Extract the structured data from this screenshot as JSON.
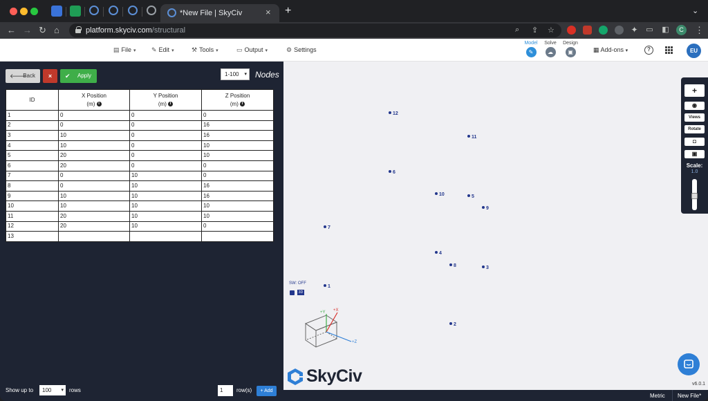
{
  "browser": {
    "active_tab_title": "*New File | SkyCiv",
    "url_host": "platform.skyciv.com",
    "url_path": "/structural",
    "profile_initial": "C"
  },
  "header": {
    "menu": [
      {
        "label": "File",
        "icon": "file-icon"
      },
      {
        "label": "Edit",
        "icon": "pencil-icon"
      },
      {
        "label": "Tools",
        "icon": "wrench-icon"
      },
      {
        "label": "Output",
        "icon": "monitor-icon"
      },
      {
        "label": "Settings",
        "icon": "gear-icon"
      }
    ],
    "steps": [
      {
        "label": "Model",
        "active": true
      },
      {
        "label": "Solve",
        "active": false
      },
      {
        "label": "Design",
        "active": false
      }
    ],
    "addons_label": "Add-ons",
    "user_initials": "EU"
  },
  "panel": {
    "back_label": "Back",
    "apply_label": "Apply",
    "range_value": "1-100",
    "title": "Nodes",
    "columns": [
      {
        "label": "ID",
        "unit": ""
      },
      {
        "label": "X Position",
        "unit": "(m)"
      },
      {
        "label": "Y Position",
        "unit": "(m)"
      },
      {
        "label": "Z Position",
        "unit": "(m)"
      }
    ],
    "rows": [
      [
        "1",
        "0",
        "0",
        "0"
      ],
      [
        "2",
        "0",
        "0",
        "16"
      ],
      [
        "3",
        "10",
        "0",
        "16"
      ],
      [
        "4",
        "10",
        "0",
        "10"
      ],
      [
        "5",
        "20",
        "0",
        "10"
      ],
      [
        "6",
        "20",
        "0",
        "0"
      ],
      [
        "7",
        "0",
        "10",
        "0"
      ],
      [
        "8",
        "0",
        "10",
        "16"
      ],
      [
        "9",
        "10",
        "10",
        "16"
      ],
      [
        "10",
        "10",
        "10",
        "10"
      ],
      [
        "11",
        "20",
        "10",
        "10"
      ],
      [
        "12",
        "20",
        "10",
        "0"
      ],
      [
        "13",
        "",
        "",
        ""
      ]
    ],
    "show_up_to_label": "Show up to",
    "show_up_to_value": "100",
    "rows_label": "rows",
    "add_rows_value": "1",
    "add_rows_label": "row(s)",
    "add_button_label": "+ Add"
  },
  "viewport": {
    "nodes": [
      "1",
      "2",
      "3",
      "4",
      "5",
      "6",
      "7",
      "8",
      "9",
      "10",
      "11",
      "12"
    ],
    "sw_label": "SW: OFF",
    "threed_label": "3D",
    "axis_labels": {
      "y": "+Y",
      "x": "+X",
      "z": "+Z"
    },
    "logo_text": "SkyCiv",
    "version": "v6.0.1"
  },
  "toolbar": {
    "add_label": "+",
    "views_label": "Views",
    "rotate_label": "Rotate",
    "scale_label": "Scale:",
    "scale_value": "1.0"
  },
  "status": {
    "units": "Metric",
    "file": "New File*"
  }
}
